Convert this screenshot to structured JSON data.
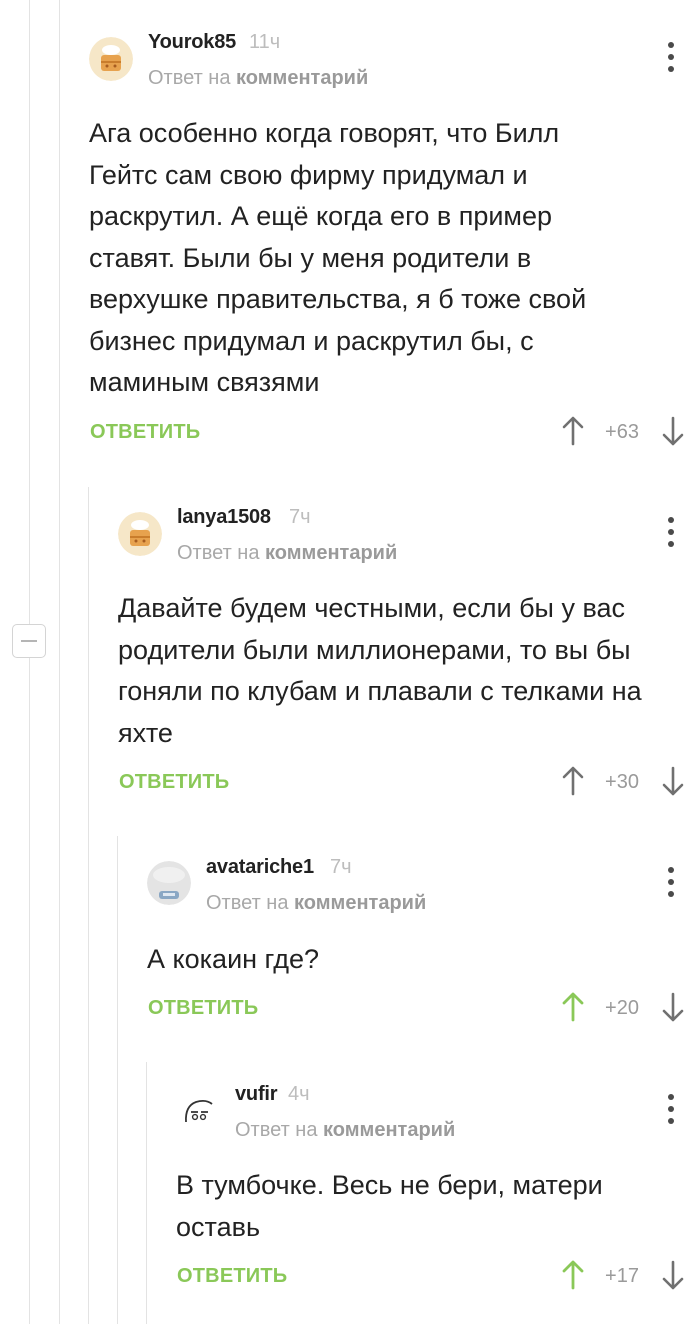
{
  "comments": [
    {
      "username": "Yourok85",
      "time": "11ч",
      "reply_prefix": "Ответ на",
      "reply_target": "комментарий",
      "text": "Ага особенно когда говорят, что Билл Гейтс сам свою фирму придумал и раскрутил. А ещё когда его в пример ставят. Были бы у меня родители в верхушке правительства, я б тоже свой бизнес придумал и раскрутил бы, с маминым связями",
      "reply_label": "ОТВЕТИТЬ",
      "rating": "+63",
      "upvoted": false,
      "avatar": "cake-avatar"
    },
    {
      "username": "lanya1508",
      "time": "7ч",
      "reply_prefix": "Ответ на",
      "reply_target": "комментарий",
      "text": "Давайте будем честными, если бы у вас родители были миллионерами, то вы бы гоняли по клубам и плавали с телками на яхте",
      "reply_label": "ОТВЕТИТЬ",
      "rating": "+30",
      "upvoted": false,
      "avatar": "cake-avatar"
    },
    {
      "username": "avatariche1",
      "time": "7ч",
      "reply_prefix": "Ответ на",
      "reply_target": "комментарий",
      "text": "А кокаин где?",
      "reply_label": "ОТВЕТИТЬ",
      "rating": "+20",
      "upvoted": true,
      "avatar": "photo-avatar"
    },
    {
      "username": "vufir",
      "time": "4ч",
      "reply_prefix": "Ответ на",
      "reply_target": "комментарий",
      "text": "В тумбочке. Весь не бери, матери оставь",
      "reply_label": "ОТВЕТИТЬ",
      "rating": "+17",
      "upvoted": true,
      "avatar": "drawn-face-avatar"
    }
  ],
  "colors": {
    "accent_green": "#8ac858",
    "text": "#222222",
    "muted": "#a8a8a8",
    "arrow_neutral": "#707070"
  }
}
